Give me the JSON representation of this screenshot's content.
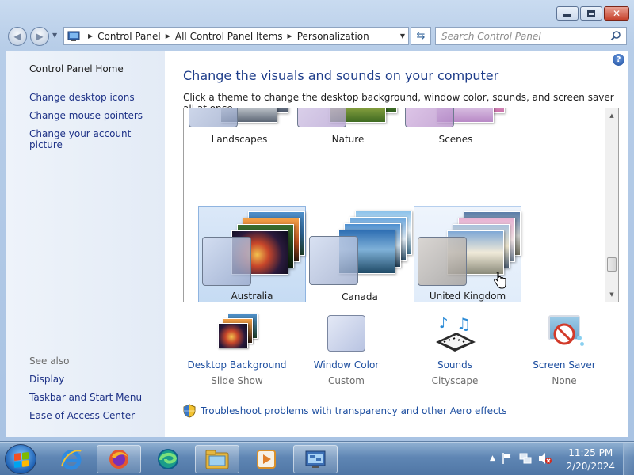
{
  "window": {
    "controls": {
      "minimize": "minimize",
      "maximize": "maximize",
      "close": "✕"
    }
  },
  "nav": {
    "breadcrumbs": [
      "Control Panel",
      "All Control Panel Items",
      "Personalization"
    ],
    "search_placeholder": "Search Control Panel"
  },
  "left_pane": {
    "home": "Control Panel Home",
    "links": [
      "Change desktop icons",
      "Change mouse pointers",
      "Change your account picture"
    ],
    "see_also_title": "See also",
    "see_also": [
      "Display",
      "Taskbar and Start Menu",
      "Ease of Access Center"
    ]
  },
  "main": {
    "help": "?",
    "heading": "Change the visuals and sounds on your computer",
    "subtext": "Click a theme to change the desktop background, window color, sounds, and screen saver all at once.",
    "themes_row1": [
      "Landscapes",
      "Nature",
      "Scenes"
    ],
    "themes_row2": [
      "Australia",
      "Canada",
      "United Kingdom"
    ],
    "selected_theme": "Australia"
  },
  "options": [
    {
      "name": "Desktop Background",
      "value": "Slide Show",
      "icon": "desktop-background-icon"
    },
    {
      "name": "Window Color",
      "value": "Custom",
      "icon": "window-color-icon"
    },
    {
      "name": "Sounds",
      "value": "Cityscape",
      "icon": "sounds-icon"
    },
    {
      "name": "Screen Saver",
      "value": "None",
      "icon": "screen-saver-icon"
    }
  ],
  "troubleshoot": "Troubleshoot problems with transparency and other Aero effects",
  "taskbar": {
    "apps": [
      "internet-explorer-icon",
      "firefox-icon",
      "edge-icon",
      "file-explorer-icon",
      "media-player-icon",
      "control-panel-icon"
    ],
    "clock_time": "11:25 PM",
    "clock_date": "2/20/2024"
  },
  "colors": {
    "link": "#1e4fa0",
    "heading": "#1e3d8a",
    "selected_theme_bg": "#c5dbf3"
  }
}
